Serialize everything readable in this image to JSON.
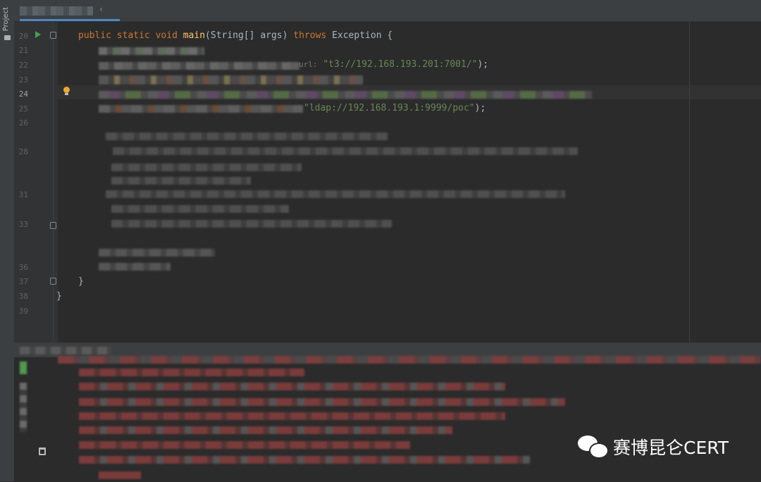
{
  "sidebar": {
    "project_label": "Project"
  },
  "tab": {
    "close_glyph": "‹"
  },
  "editor": {
    "line_numbers": [
      "20",
      "21",
      "22",
      "23",
      "24",
      "25",
      "26",
      "28",
      "31",
      "33",
      "36",
      "37",
      "38",
      "39"
    ],
    "code": {
      "kw_public": "public",
      "kw_static": "static",
      "kw_void": "void",
      "method_name": "main",
      "params": "(String[] args) ",
      "kw_throws": "throws",
      "exception": " Exception {",
      "url_hint": "url:",
      "url_string": "\"t3://192.168.193.201:7001/\"",
      "url_end": ");",
      "ldap_string": "\"ldap://192.168.193.1:9999/poc\"",
      "ldap_end": ");",
      "close_brace_inner": "}",
      "close_brace_outer": "}"
    }
  },
  "watermark": {
    "text": "赛博昆仑CERT"
  },
  "colors": {
    "keyword": "#cc7832",
    "function": "#ffc66d",
    "string": "#6a8759",
    "text": "#a9b7c6",
    "background": "#2b2b2b"
  }
}
